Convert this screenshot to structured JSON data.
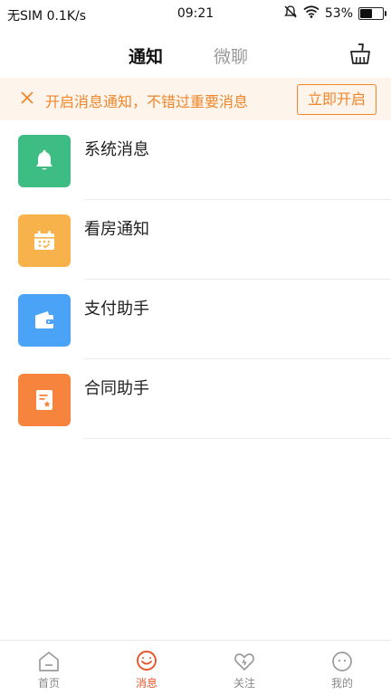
{
  "status_bar": {
    "carrier": "无SIM",
    "speed": "0.1K/s",
    "time": "09:21",
    "battery": "53%",
    "battery_level": 0.53
  },
  "header": {
    "tabs": [
      {
        "label": "通知",
        "active": true
      },
      {
        "label": "微聊",
        "active": false
      }
    ],
    "clean_icon": "broom-icon"
  },
  "banner": {
    "text": "开启消息通知，不错过重要消息",
    "button": "立即开启",
    "close_icon": "close-icon"
  },
  "list": [
    {
      "label": "系统消息",
      "icon": "bell-icon",
      "color": "#3dbd84"
    },
    {
      "label": "看房通知",
      "icon": "calendar-icon",
      "color": "#f8b24b"
    },
    {
      "label": "支付助手",
      "icon": "wallet-icon",
      "color": "#4ba3f7"
    },
    {
      "label": "合同助手",
      "icon": "contract-icon",
      "color": "#f7843d"
    }
  ],
  "bottom_nav": [
    {
      "label": "首页",
      "icon": "home-icon",
      "active": false
    },
    {
      "label": "消息",
      "icon": "message-icon",
      "active": true
    },
    {
      "label": "关注",
      "icon": "heart-icon",
      "active": false
    },
    {
      "label": "我的",
      "icon": "profile-icon",
      "active": false
    }
  ],
  "colors": {
    "accent": "#f0862a",
    "active_nav": "#e8552a",
    "banner_bg": "#fdf4ec"
  }
}
